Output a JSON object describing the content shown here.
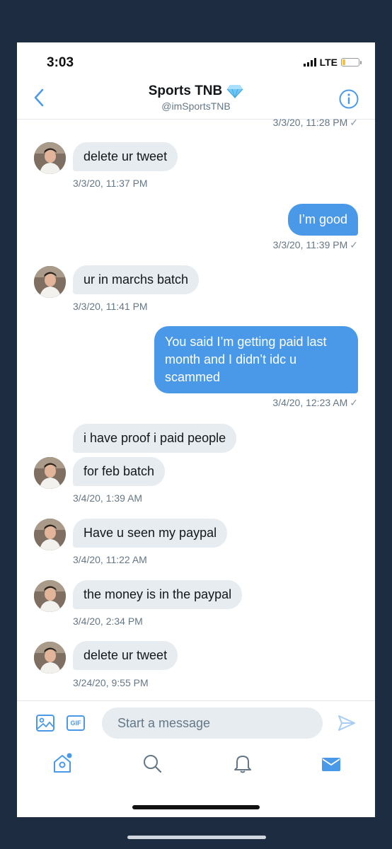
{
  "status": {
    "time": "3:03",
    "network": "LTE"
  },
  "header": {
    "title": "Sports TNB",
    "handle": "@imSportsTNB"
  },
  "messages": [
    {
      "type": "meta_out",
      "text": "3/3/20, 11:28 PM"
    },
    {
      "type": "in",
      "text": "delete ur tweet"
    },
    {
      "type": "meta_in",
      "text": "3/3/20, 11:37 PM"
    },
    {
      "type": "out",
      "text": "I’m good"
    },
    {
      "type": "meta_out",
      "text": "3/3/20, 11:39 PM"
    },
    {
      "type": "in",
      "text": "ur in marchs batch"
    },
    {
      "type": "meta_in",
      "text": "3/3/20, 11:41 PM"
    },
    {
      "type": "out",
      "text": "You said I’m getting paid last month and I didn’t idc u scammed"
    },
    {
      "type": "meta_out",
      "text": "3/4/20, 12:23 AM"
    },
    {
      "type": "in",
      "text": "i have proof i paid people"
    },
    {
      "type": "in",
      "text": "for feb batch"
    },
    {
      "type": "meta_in",
      "text": "3/4/20, 1:39 AM"
    },
    {
      "type": "in",
      "text": "Have u seen my paypal"
    },
    {
      "type": "meta_in",
      "text": "3/4/20, 11:22 AM"
    },
    {
      "type": "in",
      "text": "the money is in the paypal"
    },
    {
      "type": "meta_in",
      "text": "3/4/20, 2:34 PM"
    },
    {
      "type": "in",
      "text": "delete ur tweet"
    },
    {
      "type": "meta_in",
      "text": "3/24/20, 9:55 PM"
    }
  ],
  "composer": {
    "placeholder": "Start a message",
    "gif_label": "GIF"
  },
  "icons": {
    "back": "chevron-left-icon",
    "verified": "diamond-icon",
    "info": "info-icon",
    "media": "image-icon",
    "gif": "gif-icon",
    "send": "send-icon",
    "home": "home-icon",
    "search": "search-icon",
    "notifications": "bell-icon",
    "messages": "mail-icon"
  },
  "colors": {
    "accent": "#4a99e9",
    "bubble_in": "#e6ecf0",
    "background": "#1d2c40"
  }
}
